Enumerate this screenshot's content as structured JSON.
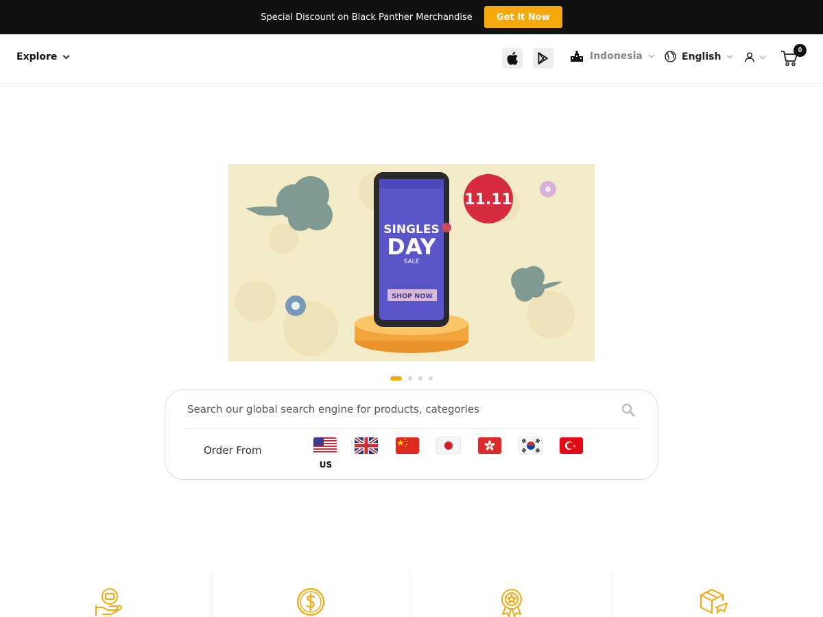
{
  "promo": {
    "text": "Special Discount on Black Panther Merchandise",
    "button": "Get It Now"
  },
  "header": {
    "explore": "Explore",
    "country": "Indonesia",
    "language": "English",
    "cart_count": "0"
  },
  "banner": {
    "badge": "11.11",
    "line1": "SINGLES",
    "line2": "DAY",
    "line3": "SALE",
    "cta": "SHOP NOW",
    "slides": 4,
    "active_slide": 1
  },
  "search": {
    "placeholder": "Search our global search engine for products, categories",
    "order_from": "Order From",
    "selected_code": "US"
  },
  "colors": {
    "accent": "#f5a80a",
    "promo_bg": "#111111",
    "banner_bg": "#f4ecc8"
  },
  "icons": [
    "apple-icon",
    "google-play-icon",
    "country-icon",
    "globe-icon",
    "user-icon",
    "cart-icon",
    "search-icon",
    "hand-coin-icon",
    "dollar-icon",
    "award-icon",
    "plane-box-icon"
  ]
}
